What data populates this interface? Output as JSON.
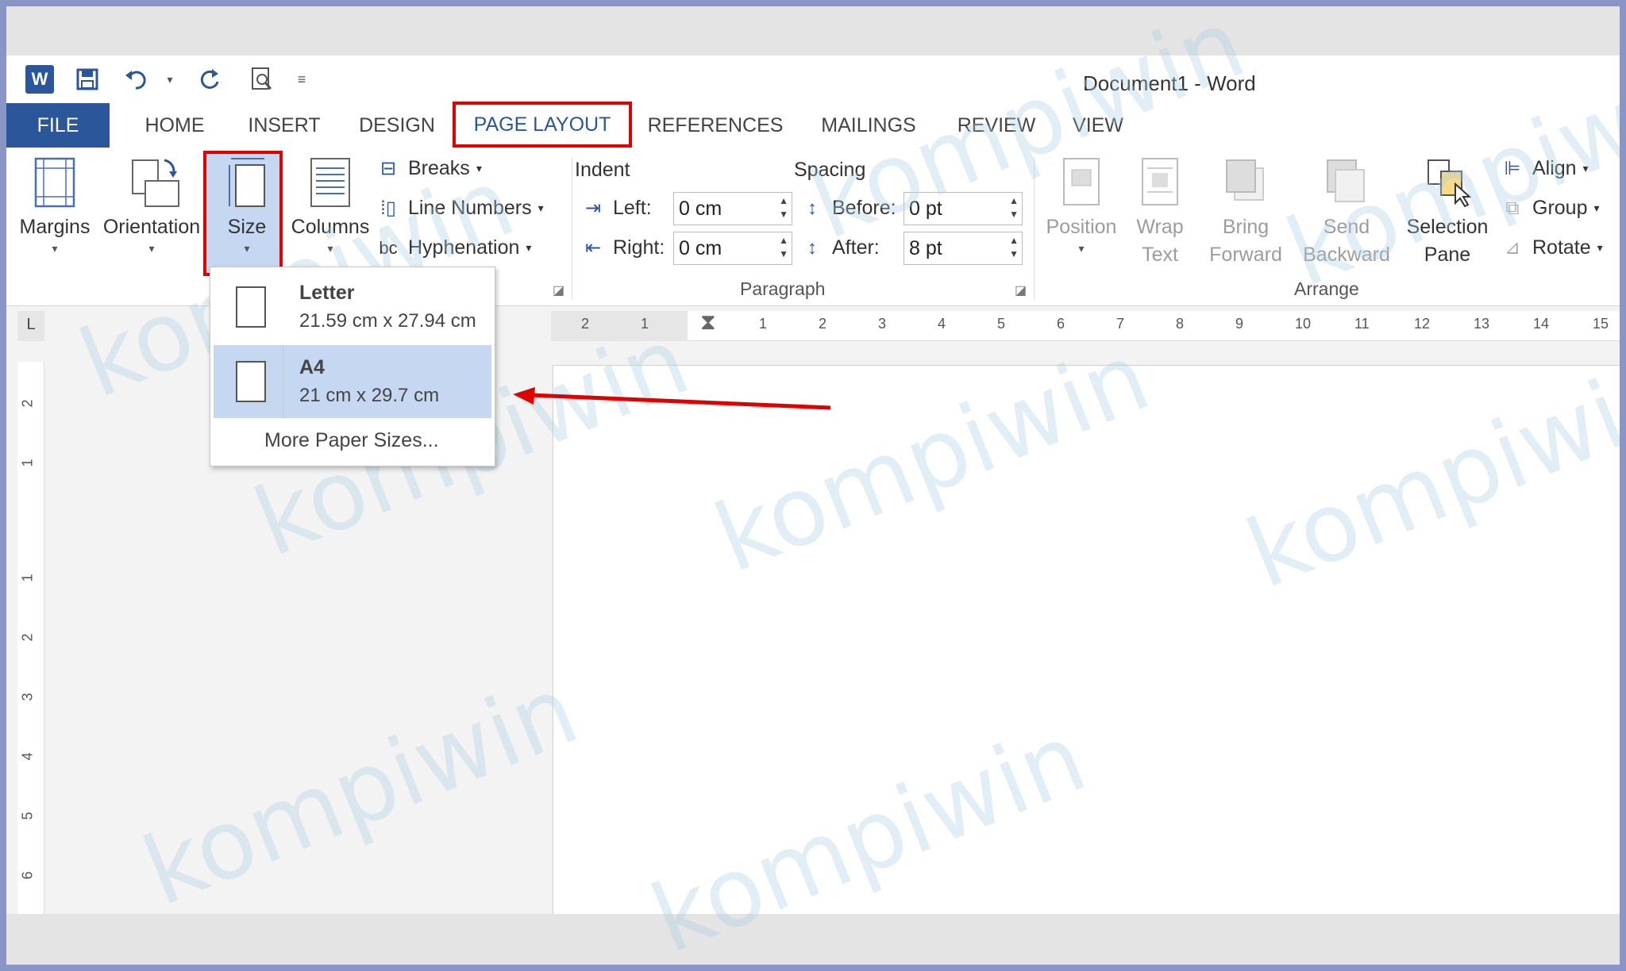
{
  "window": {
    "title": "Document1 - Word"
  },
  "quick_access": {
    "icons": [
      "word-logo-icon",
      "save-icon",
      "undo-icon",
      "redo-icon",
      "print-preview-icon",
      "customize-qat-icon"
    ],
    "logo_letter": "W"
  },
  "tabs": [
    "FILE",
    "HOME",
    "INSERT",
    "DESIGN",
    "PAGE LAYOUT",
    "REFERENCES",
    "MAILINGS",
    "REVIEW",
    "VIEW"
  ],
  "active_tab": "PAGE LAYOUT",
  "page_setup": {
    "margins": "Margins",
    "orientation": "Orientation",
    "size": "Size",
    "columns": "Columns",
    "breaks": "Breaks",
    "line_numbers": "Line Numbers",
    "hyphenation": "Hyphenation",
    "caret": "▾"
  },
  "paragraph": {
    "group_label": "Paragraph",
    "indent_label": "Indent",
    "spacing_label": "Spacing",
    "left_label": "Left:",
    "right_label": "Right:",
    "before_label": "Before:",
    "after_label": "After:",
    "left_value": "0 cm",
    "right_value": "0 cm",
    "before_value": "0 pt",
    "after_value": "8 pt"
  },
  "arrange": {
    "group_label": "Arrange",
    "position": "Position",
    "wrap_text_1": "Wrap",
    "wrap_text_2": "Text",
    "bring_forward_1": "Bring",
    "bring_forward_2": "Forward",
    "send_backward_1": "Send",
    "send_backward_2": "Backward",
    "selection_pane_1": "Selection",
    "selection_pane_2": "Pane",
    "align": "Align",
    "group": "Group",
    "rotate": "Rotate"
  },
  "size_dropdown": {
    "options": [
      {
        "name": "Letter",
        "dims": "21.59 cm x 27.94 cm"
      },
      {
        "name": "A4",
        "dims": "21 cm x 29.7 cm"
      }
    ],
    "selected": "A4",
    "more": "More Paper Sizes..."
  },
  "ruler": {
    "horizontal": [
      "2",
      "1",
      "1",
      "2",
      "3",
      "4",
      "5",
      "6",
      "7",
      "8",
      "9",
      "10",
      "11",
      "12",
      "13",
      "14",
      "15"
    ],
    "vertical": [
      "2",
      "1",
      "1",
      "2",
      "3",
      "4",
      "5",
      "6"
    ],
    "corner": "L"
  },
  "watermark": "kompiwin",
  "colors": {
    "accent": "#2b579a",
    "highlight": "#e00000",
    "selected": "#c5d7f1"
  }
}
